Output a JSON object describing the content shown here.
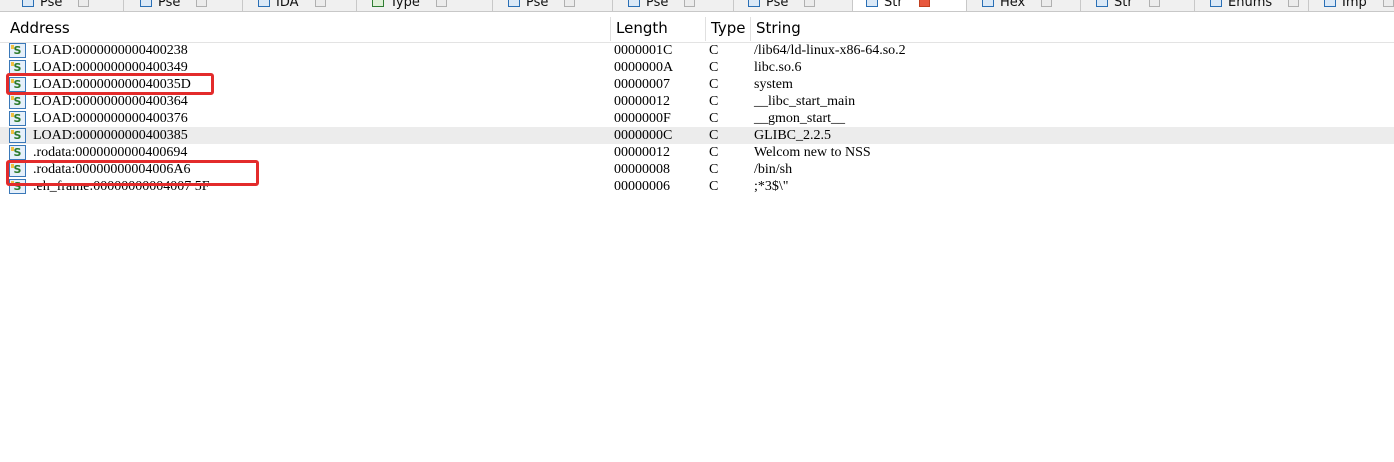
{
  "tabs": [
    {
      "label": "Pse",
      "icon": "pseudocode-icon"
    },
    {
      "label": "Pse",
      "icon": "pseudocode-icon"
    },
    {
      "label": "IDA",
      "icon": "ida-view-icon"
    },
    {
      "label": "Type",
      "icon": "local-types-icon"
    },
    {
      "label": "Pse",
      "icon": "pseudocode-icon"
    },
    {
      "label": "Pse",
      "icon": "pseudocode-icon"
    },
    {
      "label": "Pse",
      "icon": "pseudocode-icon"
    },
    {
      "label": "Str",
      "icon": "strings-icon",
      "active": true
    },
    {
      "label": "Hex",
      "icon": "hex-view-icon"
    },
    {
      "label": "Str",
      "icon": "structures-icon"
    },
    {
      "label": "Enums",
      "icon": "enums-icon"
    },
    {
      "label": "Imp",
      "icon": "imports-icon"
    }
  ],
  "columns": {
    "address": "Address",
    "length": "Length",
    "type": "Type",
    "string": "String"
  },
  "rows": [
    {
      "address": "LOAD:0000000000400238",
      "length": "0000001C",
      "type": "C",
      "string": "/lib64/ld-linux-x86-64.so.2"
    },
    {
      "address": "LOAD:0000000000400349",
      "length": "0000000A",
      "type": "C",
      "string": "libc.so.6"
    },
    {
      "address": "LOAD:000000000040035D",
      "length": "00000007",
      "type": "C",
      "string": "system"
    },
    {
      "address": "LOAD:0000000000400364",
      "length": "00000012",
      "type": "C",
      "string": "__libc_start_main"
    },
    {
      "address": "LOAD:0000000000400376",
      "length": "0000000F",
      "type": "C",
      "string": "__gmon_start__"
    },
    {
      "address": "LOAD:0000000000400385",
      "length": "0000000C",
      "type": "C",
      "string": "GLIBC_2.2.5",
      "selected": true
    },
    {
      "address": ".rodata:0000000000400694",
      "length": "00000012",
      "type": "C",
      "string": "Welcom new to NSS"
    },
    {
      "address": ".rodata:00000000004006A6",
      "length": "00000008",
      "type": "C",
      "string": "/bin/sh"
    },
    {
      "address": ".eh_frame:00000000004007 5F",
      "length": "00000006",
      "type": "C",
      "string": ";*3$\\\""
    }
  ],
  "highlight_color": "#e32b2b",
  "string_icon_glyph": "S"
}
